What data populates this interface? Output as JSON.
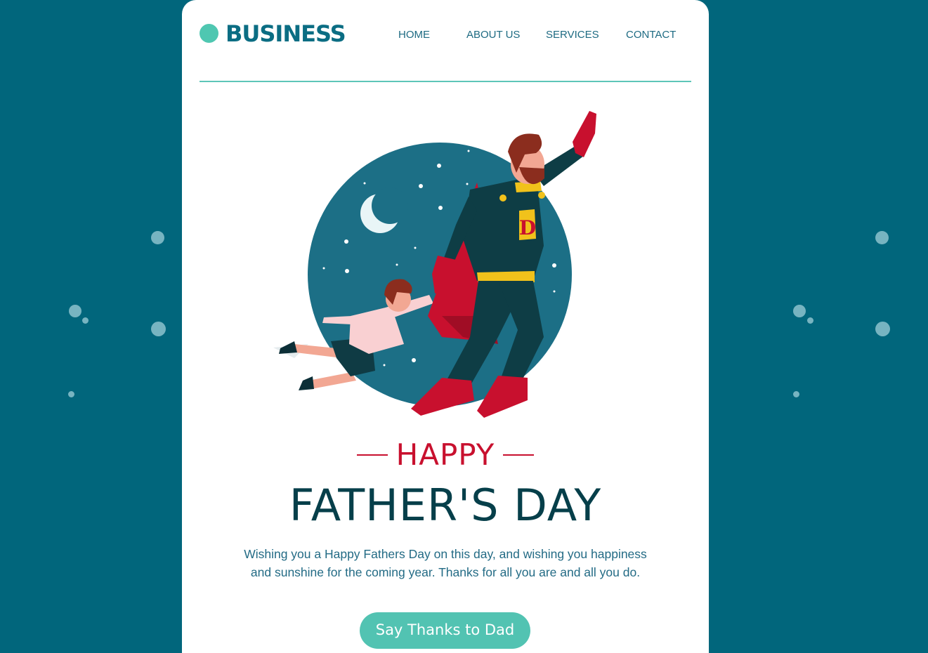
{
  "brand": {
    "name": "BUSINESS"
  },
  "nav": {
    "items": [
      {
        "label": "HOME"
      },
      {
        "label": "ABOUT US"
      },
      {
        "label": "SERVICES"
      },
      {
        "label": "CONTACT"
      }
    ]
  },
  "hero": {
    "illustration": "superhero-father-flying-with-son",
    "chest_letter": "D"
  },
  "headline": {
    "pre": "HAPPY",
    "main": "FATHER'S DAY"
  },
  "message": {
    "text": "Wishing you a Happy Fathers Day on this day, and wishing you happiness and sunshine for the coming year. Thanks for all you are and all you do."
  },
  "cta": {
    "label": "Say Thanks to Dad"
  },
  "colors": {
    "background": "#01667c",
    "card": "#ffffff",
    "brand_teal": "#0b6d83",
    "accent_mint": "#4fc7b1",
    "headline_red": "#c8102e",
    "title_dark": "#063f4a",
    "text_teal": "#236b85"
  }
}
